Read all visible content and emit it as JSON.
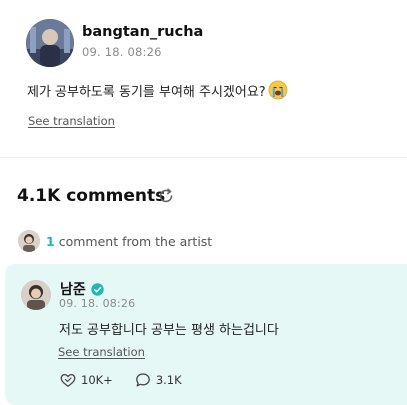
{
  "post": {
    "username": "bangtan_rucha",
    "date": "09. 18. 08:26",
    "body": "제가 공부하도록 동기를 부여해 주시겠어요?",
    "emoji": "loudly-crying-face-icon",
    "see_translation": "See translation"
  },
  "comments": {
    "title": "4.1K comments",
    "refresh_icon": "refresh-icon",
    "artist_count": "1",
    "artist_text": "comment from the artist",
    "highlighted": {
      "author": "남준",
      "verified_icon": "verified-check-icon",
      "date": "09. 18. 08:26",
      "body": "저도 공부합니다 공부는 평생 하는겁니다",
      "see_translation": "See translation",
      "likes": "10K+",
      "replies": "3.1K",
      "like_icon": "heart-like-icon",
      "reply_icon": "speech-bubble-icon"
    }
  },
  "colors": {
    "accent": "#1fb8b5",
    "card_background": "#e6f8f6",
    "muted_text": "#8a8a8a"
  }
}
